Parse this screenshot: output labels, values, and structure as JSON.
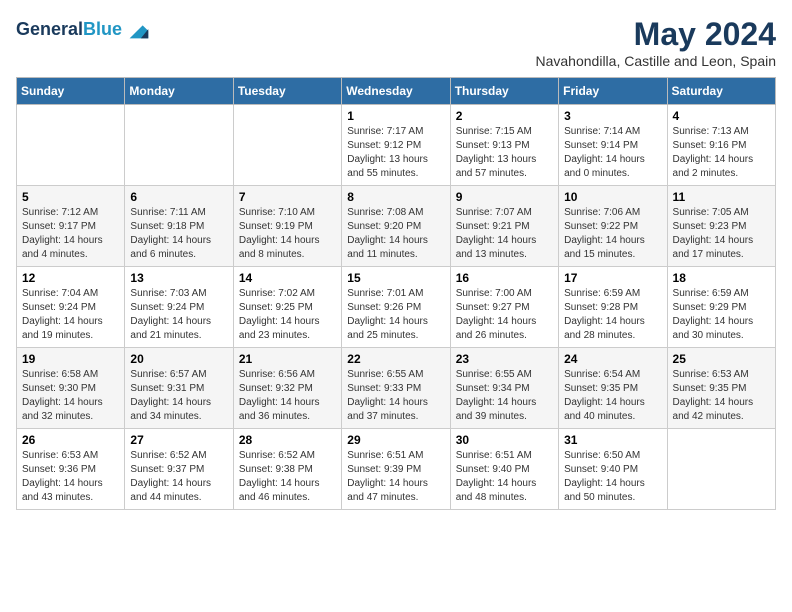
{
  "header": {
    "logo_line1": "General",
    "logo_line2": "Blue",
    "month_year": "May 2024",
    "location": "Navahondilla, Castille and Leon, Spain"
  },
  "weekdays": [
    "Sunday",
    "Monday",
    "Tuesday",
    "Wednesday",
    "Thursday",
    "Friday",
    "Saturday"
  ],
  "weeks": [
    [
      {
        "day": "",
        "sunrise": "",
        "sunset": "",
        "daylight": ""
      },
      {
        "day": "",
        "sunrise": "",
        "sunset": "",
        "daylight": ""
      },
      {
        "day": "",
        "sunrise": "",
        "sunset": "",
        "daylight": ""
      },
      {
        "day": "1",
        "sunrise": "Sunrise: 7:17 AM",
        "sunset": "Sunset: 9:12 PM",
        "daylight": "Daylight: 13 hours and 55 minutes."
      },
      {
        "day": "2",
        "sunrise": "Sunrise: 7:15 AM",
        "sunset": "Sunset: 9:13 PM",
        "daylight": "Daylight: 13 hours and 57 minutes."
      },
      {
        "day": "3",
        "sunrise": "Sunrise: 7:14 AM",
        "sunset": "Sunset: 9:14 PM",
        "daylight": "Daylight: 14 hours and 0 minutes."
      },
      {
        "day": "4",
        "sunrise": "Sunrise: 7:13 AM",
        "sunset": "Sunset: 9:16 PM",
        "daylight": "Daylight: 14 hours and 2 minutes."
      }
    ],
    [
      {
        "day": "5",
        "sunrise": "Sunrise: 7:12 AM",
        "sunset": "Sunset: 9:17 PM",
        "daylight": "Daylight: 14 hours and 4 minutes."
      },
      {
        "day": "6",
        "sunrise": "Sunrise: 7:11 AM",
        "sunset": "Sunset: 9:18 PM",
        "daylight": "Daylight: 14 hours and 6 minutes."
      },
      {
        "day": "7",
        "sunrise": "Sunrise: 7:10 AM",
        "sunset": "Sunset: 9:19 PM",
        "daylight": "Daylight: 14 hours and 8 minutes."
      },
      {
        "day": "8",
        "sunrise": "Sunrise: 7:08 AM",
        "sunset": "Sunset: 9:20 PM",
        "daylight": "Daylight: 14 hours and 11 minutes."
      },
      {
        "day": "9",
        "sunrise": "Sunrise: 7:07 AM",
        "sunset": "Sunset: 9:21 PM",
        "daylight": "Daylight: 14 hours and 13 minutes."
      },
      {
        "day": "10",
        "sunrise": "Sunrise: 7:06 AM",
        "sunset": "Sunset: 9:22 PM",
        "daylight": "Daylight: 14 hours and 15 minutes."
      },
      {
        "day": "11",
        "sunrise": "Sunrise: 7:05 AM",
        "sunset": "Sunset: 9:23 PM",
        "daylight": "Daylight: 14 hours and 17 minutes."
      }
    ],
    [
      {
        "day": "12",
        "sunrise": "Sunrise: 7:04 AM",
        "sunset": "Sunset: 9:24 PM",
        "daylight": "Daylight: 14 hours and 19 minutes."
      },
      {
        "day": "13",
        "sunrise": "Sunrise: 7:03 AM",
        "sunset": "Sunset: 9:24 PM",
        "daylight": "Daylight: 14 hours and 21 minutes."
      },
      {
        "day": "14",
        "sunrise": "Sunrise: 7:02 AM",
        "sunset": "Sunset: 9:25 PM",
        "daylight": "Daylight: 14 hours and 23 minutes."
      },
      {
        "day": "15",
        "sunrise": "Sunrise: 7:01 AM",
        "sunset": "Sunset: 9:26 PM",
        "daylight": "Daylight: 14 hours and 25 minutes."
      },
      {
        "day": "16",
        "sunrise": "Sunrise: 7:00 AM",
        "sunset": "Sunset: 9:27 PM",
        "daylight": "Daylight: 14 hours and 26 minutes."
      },
      {
        "day": "17",
        "sunrise": "Sunrise: 6:59 AM",
        "sunset": "Sunset: 9:28 PM",
        "daylight": "Daylight: 14 hours and 28 minutes."
      },
      {
        "day": "18",
        "sunrise": "Sunrise: 6:59 AM",
        "sunset": "Sunset: 9:29 PM",
        "daylight": "Daylight: 14 hours and 30 minutes."
      }
    ],
    [
      {
        "day": "19",
        "sunrise": "Sunrise: 6:58 AM",
        "sunset": "Sunset: 9:30 PM",
        "daylight": "Daylight: 14 hours and 32 minutes."
      },
      {
        "day": "20",
        "sunrise": "Sunrise: 6:57 AM",
        "sunset": "Sunset: 9:31 PM",
        "daylight": "Daylight: 14 hours and 34 minutes."
      },
      {
        "day": "21",
        "sunrise": "Sunrise: 6:56 AM",
        "sunset": "Sunset: 9:32 PM",
        "daylight": "Daylight: 14 hours and 36 minutes."
      },
      {
        "day": "22",
        "sunrise": "Sunrise: 6:55 AM",
        "sunset": "Sunset: 9:33 PM",
        "daylight": "Daylight: 14 hours and 37 minutes."
      },
      {
        "day": "23",
        "sunrise": "Sunrise: 6:55 AM",
        "sunset": "Sunset: 9:34 PM",
        "daylight": "Daylight: 14 hours and 39 minutes."
      },
      {
        "day": "24",
        "sunrise": "Sunrise: 6:54 AM",
        "sunset": "Sunset: 9:35 PM",
        "daylight": "Daylight: 14 hours and 40 minutes."
      },
      {
        "day": "25",
        "sunrise": "Sunrise: 6:53 AM",
        "sunset": "Sunset: 9:35 PM",
        "daylight": "Daylight: 14 hours and 42 minutes."
      }
    ],
    [
      {
        "day": "26",
        "sunrise": "Sunrise: 6:53 AM",
        "sunset": "Sunset: 9:36 PM",
        "daylight": "Daylight: 14 hours and 43 minutes."
      },
      {
        "day": "27",
        "sunrise": "Sunrise: 6:52 AM",
        "sunset": "Sunset: 9:37 PM",
        "daylight": "Daylight: 14 hours and 44 minutes."
      },
      {
        "day": "28",
        "sunrise": "Sunrise: 6:52 AM",
        "sunset": "Sunset: 9:38 PM",
        "daylight": "Daylight: 14 hours and 46 minutes."
      },
      {
        "day": "29",
        "sunrise": "Sunrise: 6:51 AM",
        "sunset": "Sunset: 9:39 PM",
        "daylight": "Daylight: 14 hours and 47 minutes."
      },
      {
        "day": "30",
        "sunrise": "Sunrise: 6:51 AM",
        "sunset": "Sunset: 9:40 PM",
        "daylight": "Daylight: 14 hours and 48 minutes."
      },
      {
        "day": "31",
        "sunrise": "Sunrise: 6:50 AM",
        "sunset": "Sunset: 9:40 PM",
        "daylight": "Daylight: 14 hours and 50 minutes."
      },
      {
        "day": "",
        "sunrise": "",
        "sunset": "",
        "daylight": ""
      }
    ]
  ]
}
